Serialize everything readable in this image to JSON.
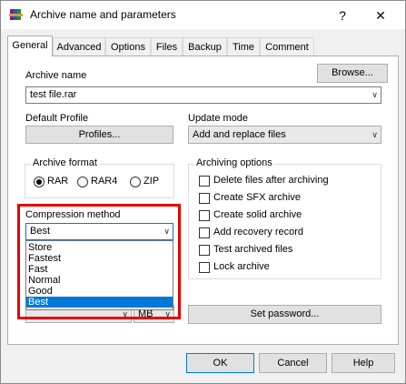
{
  "window": {
    "title": "Archive name and parameters",
    "help_glyph": "?",
    "close_glyph": "✕",
    "icon": "winrar-books-icon"
  },
  "tabs": [
    "General",
    "Advanced",
    "Options",
    "Files",
    "Backup",
    "Time",
    "Comment"
  ],
  "archive_name": {
    "label": "Archive name",
    "value": "test file.rar",
    "browse_label": "Browse..."
  },
  "default_profile": {
    "label": "Default Profile",
    "button_label": "Profiles..."
  },
  "update_mode": {
    "label": "Update mode",
    "value": "Add and replace files"
  },
  "archive_format": {
    "label": "Archive format",
    "options": [
      "RAR",
      "RAR4",
      "ZIP"
    ],
    "selected": "RAR"
  },
  "compression_method": {
    "label": "Compression method",
    "value": "Best",
    "options": [
      "Store",
      "Fastest",
      "Fast",
      "Normal",
      "Good",
      "Best"
    ],
    "highlighted": "Best"
  },
  "dictionary": {
    "unit": "MB"
  },
  "archiving_options": {
    "label": "Archiving options",
    "items": [
      "Delete files after archiving",
      "Create SFX archive",
      "Create solid archive",
      "Add recovery record",
      "Test archived files",
      "Lock archive"
    ]
  },
  "set_password_label": "Set password...",
  "buttons": {
    "ok": "OK",
    "cancel": "Cancel",
    "help": "Help"
  },
  "colors": {
    "selection": "#0078d7",
    "highlight_box": "#e60000"
  }
}
